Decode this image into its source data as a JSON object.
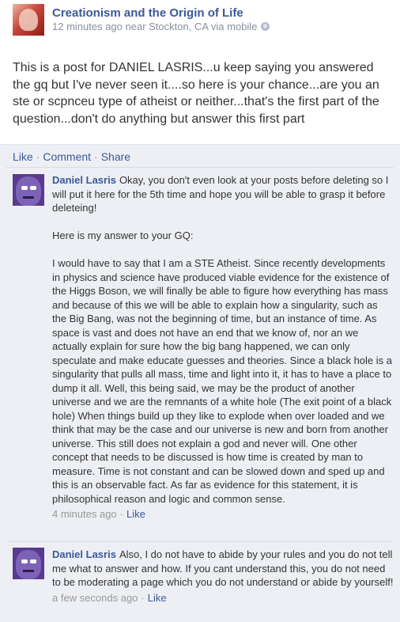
{
  "post": {
    "page_name": "Creationism and the Origin of Life",
    "meta": "12 minutes ago near Stockton, CA via mobile",
    "text": "This is a post for DANIEL LASRIS...u keep saying you answered the gq but I've never seen it....so here is your chance...are you an ste or scpnceu type of atheist or neither...that's the first part of the question...don't do anything but answer this first part",
    "actions": {
      "like": "Like",
      "comment": "Comment",
      "share": "Share"
    },
    "separator": "·"
  },
  "comments": [
    {
      "author": "Daniel Lasris",
      "text_first": "Okay, you don't even look at your posts before deleting so I will put it here for the 5th time and hope you will be able to grasp it before deleteing!",
      "text_second": "Here is my answer to your GQ:",
      "text_third": "I would have to say that I am a STE Atheist. Since recently developments in physics and science have produced viable evidence for the existence of the Higgs Boson, we will finally be able to figure how everything has mass and because of this we will be able to explain how a singularity, such as the Big Bang, was not the beginning of time, but an instance of time. As space is vast and does not have an end that we know of, nor an we actually explain for sure how the big bang happened, we can only speculate and make educate guesses and theories. Since a black hole is a singularity that pulls all mass, time and light into it, it has to have a place to dump it all. Well, this being said, we may be the product of another universe and we are the remnants of a white hole (The exit point of a black hole) When things build up they like to explode when over loaded and we think that may be the case and our universe is new and born from another universe. This still does not explain a god and never will. One other concept that needs to be discussed is how time is created by man to measure. Time is not constant and can be slowed down and sped up and this is an observable fact. As far as evidence for this statement, it is philosophical reason and logic and common sense.",
      "time": "4 minutes ago",
      "like": "Like"
    },
    {
      "author": "Daniel Lasris",
      "text_first": "Also, I do not have to abide by your rules and you do not tell me what to answer and how. If you cant understand this, you do not need to be moderating a page which you do not understand or abide by yourself!",
      "time": "a few seconds ago",
      "like": "Like"
    }
  ]
}
